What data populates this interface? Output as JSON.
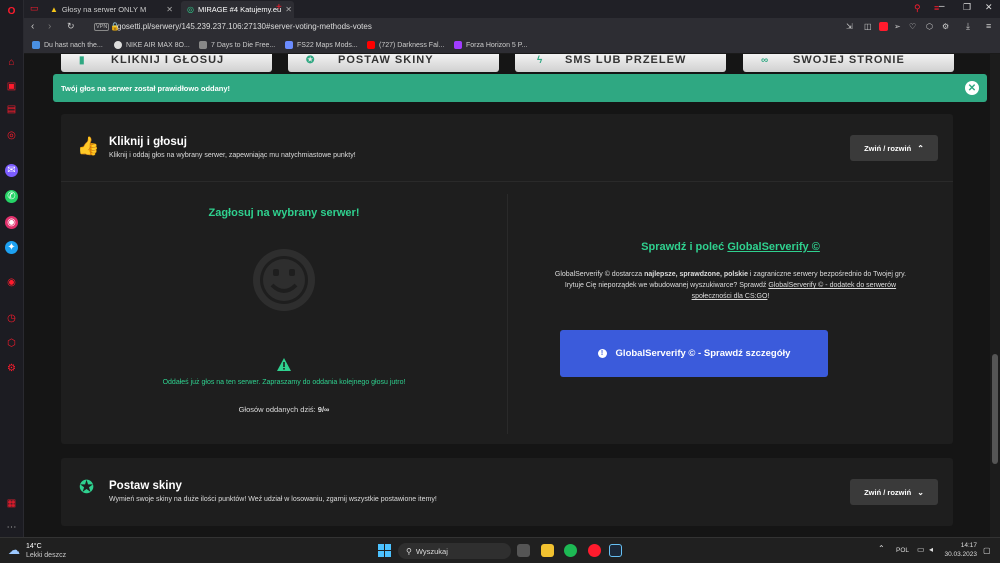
{
  "browser": {
    "tabs": [
      {
        "title": "Głosy na serwer ONLY M"
      },
      {
        "title": "MIRAGE #4 Katujemy.eu"
      }
    ],
    "new_tab": "+",
    "url_badge": "VPN",
    "url": "gosetti.pl/serwery/145.239.237.106:27130#server-voting-methods-votes",
    "bookmarks": [
      {
        "label": "Du hast nach the..."
      },
      {
        "label": "NIKE AIR MAX 8O..."
      },
      {
        "label": "7 Days to Die Free..."
      },
      {
        "label": "FS22 Maps Mods..."
      },
      {
        "label": "(727) Darkness Fal..."
      },
      {
        "label": "Forza Horizon 5 P..."
      }
    ]
  },
  "page": {
    "top_cards": [
      "KLIKNIJ I GŁOSUJ",
      "POSTAW SKINY",
      "SMS LUB PRZELEW",
      "SWOJEJ STRONIE"
    ],
    "alert": {
      "text": "Twój głos na serwer został prawidłowo oddany!",
      "close": "✕"
    },
    "panel1": {
      "title": "Kliknij i głosuj",
      "desc": "Kliknij i oddaj głos na wybrany serwer, zapewniając mu natychmiastowe punkty!",
      "toggle": "Zwiń / rozwiń",
      "vote_heading": "Zagłosuj na wybrany serwer!",
      "warning": "Oddałeś już głos na ten serwer. Zapraszamy do oddania kolejnego głosu jutro!",
      "votes_label": "Głosów oddanych dziś:",
      "votes_value": "9/∞",
      "promo_heading_prefix": "Sprawdź i poleć",
      "promo_heading_link": "GlobalServerify ©",
      "promo_line1_a": "GlobalServerify © dostarcza ",
      "promo_line1_b": "najlepsze, sprawdzone, polskie",
      "promo_line1_c": " i zagraniczne serwery bezpośrednio do Twojej gry.",
      "promo_line2_a": "Irytuje Cię nieporządek we wbudowanej wyszukiwarce? Sprawdź ",
      "promo_line2_link": "GlobalServerify © - dodatek do serwerów",
      "promo_line3_link": "społeczności dla CS:GO",
      "promo_line3_end": "!",
      "cta": "GlobalServerify © - Sprawdź szczegóły"
    },
    "panel2": {
      "title": "Postaw skiny",
      "desc": "Wymień swoje skiny na duże ilości punktów! Weź udział w losowaniu, zgarnij wszystkie postawione itemy!",
      "toggle": "Zwiń / rozwiń"
    }
  },
  "taskbar": {
    "weather_temp": "14°C",
    "weather_desc": "Lekki deszcz",
    "search": "Wyszukaj",
    "lang": "POL",
    "time": "14:17",
    "date": "30.03.2023"
  },
  "colors": {
    "accent_green": "#2fd18f",
    "alert_green": "#2fa882",
    "cta_blue": "#3b5bdb"
  }
}
